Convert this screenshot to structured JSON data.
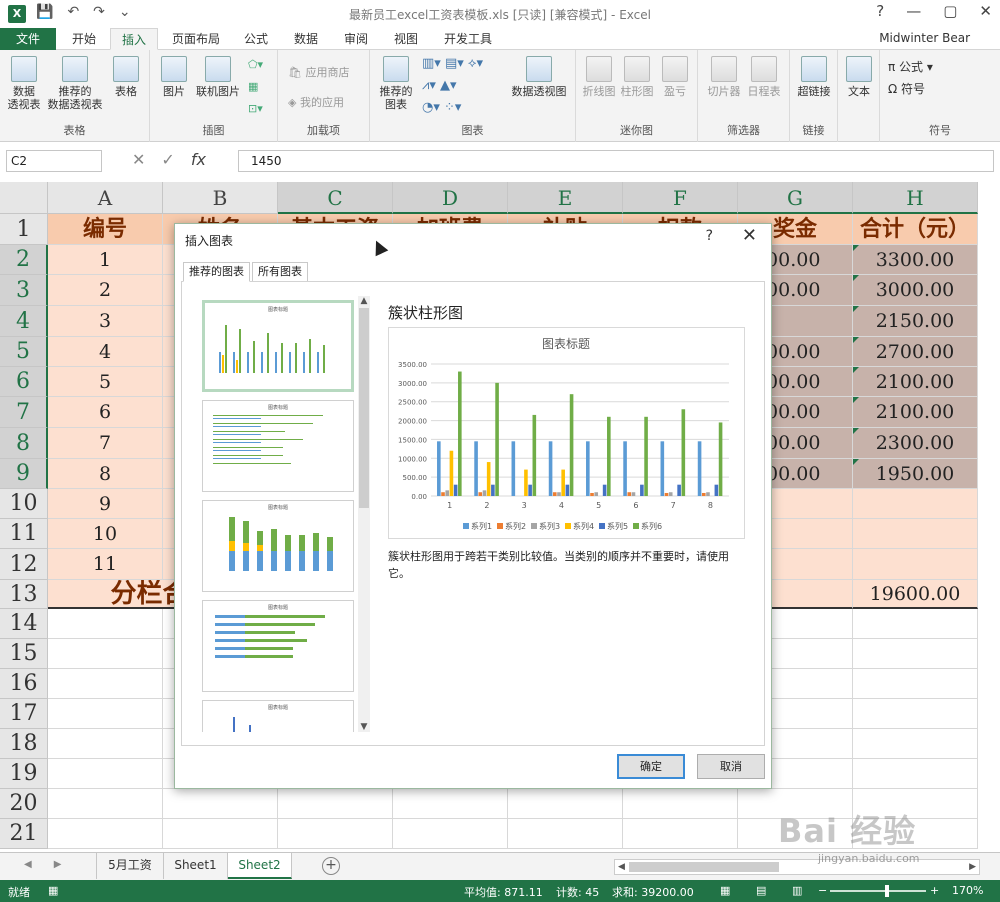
{
  "window": {
    "title": "最新员工excel工资表模板.xls [只读] [兼容模式] - Excel",
    "help": "?",
    "minimize": "—",
    "restore": "▢",
    "close": "✕"
  },
  "qat": {
    "save": "💾",
    "undo": "↶",
    "redo": "↷",
    "custom": "⌄"
  },
  "ribbon": {
    "file_tab": "文件",
    "tabs": [
      "开始",
      "插入",
      "页面布局",
      "公式",
      "数据",
      "审阅",
      "视图",
      "开发工具"
    ],
    "active_tab": "插入",
    "user": "Midwinter Bear",
    "groups": {
      "tables": {
        "label": "表格",
        "pivot": "数据\n透视表",
        "recommended_pivot": "推荐的\n数据透视表",
        "table": "表格"
      },
      "illustrations": {
        "label": "插图",
        "pictures": "图片",
        "online_pictures": "联机图片"
      },
      "addins": {
        "label": "加载项",
        "store": "应用商店",
        "my_apps": "我的应用"
      },
      "charts": {
        "label": "图表",
        "recommended": "推荐的\n图表",
        "pivot_chart": "数据透视图"
      },
      "sparklines": {
        "label": "迷你图",
        "line": "折线图",
        "column": "柱形图",
        "winloss": "盈亏"
      },
      "filters": {
        "label": "筛选器",
        "slicer": "切片器",
        "timeline": "日程表"
      },
      "links": {
        "label": "链接",
        "hyperlink": "超链接"
      },
      "text": {
        "label": "",
        "text": "文本"
      },
      "symbols": {
        "label": "符号",
        "equation": "公式",
        "symbol": "符号"
      }
    }
  },
  "formula_bar": {
    "name_box": "C2",
    "cancel": "✕",
    "enter": "✓",
    "fx": "fx",
    "formula": "1450"
  },
  "sheet": {
    "columns": [
      "A",
      "B",
      "C",
      "D",
      "E",
      "F",
      "G",
      "H"
    ],
    "rows": [
      "1",
      "2",
      "3",
      "4",
      "5",
      "6",
      "7",
      "8",
      "9",
      "10",
      "11",
      "12",
      "13",
      "14",
      "15",
      "16",
      "17",
      "18",
      "19",
      "20",
      "21"
    ],
    "header_row": {
      "A": "编号",
      "B": "姓名",
      "C": "基本工资",
      "D": "加班费",
      "E": "补贴",
      "F": "扣款",
      "G": "奖金",
      "H": "合计（元）"
    },
    "col_a": [
      "1",
      "2",
      "3",
      "4",
      "5",
      "6",
      "7",
      "8",
      "9",
      "10",
      "11"
    ],
    "col_g": [
      ".00.00",
      ".00.00",
      "",
      ".00.00",
      ".00.00",
      ".00.00",
      ".00.00",
      ".00.00"
    ],
    "col_h": [
      "3300.00",
      "3000.00",
      "2150.00",
      "2700.00",
      "2100.00",
      "2100.00",
      "2300.00",
      "1950.00"
    ],
    "total_label": "分栏合计",
    "total_value": "19600.00"
  },
  "dialog": {
    "title": "插入图表",
    "help": "?",
    "close": "✕",
    "tab_recommended": "推荐的图表",
    "tab_all": "所有图表",
    "chart_name": "簇状柱形图",
    "description": "簇状柱形图用于跨若干类别比较值。当类别的顺序并不重要时，请使用它。",
    "ok": "确定",
    "cancel": "取消",
    "thumb_title": "图表标题",
    "scroll_up": "▲",
    "scroll_down": "▼"
  },
  "chart_data": {
    "type": "bar",
    "title": "图表标题",
    "categories": [
      "1",
      "2",
      "3",
      "4",
      "5",
      "6",
      "7",
      "8"
    ],
    "ylim": [
      0,
      3500
    ],
    "yticks": [
      "0.00",
      "500.00",
      "1000.00",
      "1500.00",
      "2000.00",
      "2500.00",
      "3000.00",
      "3500.00"
    ],
    "series": [
      {
        "name": "系列1",
        "color": "#5b9bd5",
        "values": [
          1450,
          1450,
          1450,
          1450,
          1450,
          1450,
          1450,
          1450
        ]
      },
      {
        "name": "系列2",
        "color": "#ed7d31",
        "values": [
          100,
          100,
          0,
          100,
          80,
          100,
          80,
          80
        ]
      },
      {
        "name": "系列3",
        "color": "#a5a5a5",
        "values": [
          150,
          150,
          0,
          100,
          100,
          100,
          100,
          100
        ]
      },
      {
        "name": "系列4",
        "color": "#ffc000",
        "values": [
          1200,
          900,
          700,
          700,
          0,
          0,
          0,
          0
        ]
      },
      {
        "name": "系列5",
        "color": "#4472c4",
        "values": [
          300,
          300,
          300,
          300,
          300,
          300,
          300,
          300
        ]
      },
      {
        "name": "系列6",
        "color": "#70ad47",
        "values": [
          3300,
          3000,
          2150,
          2700,
          2100,
          2100,
          2300,
          1950
        ]
      }
    ],
    "legend": "bottom",
    "grid": true
  },
  "sheet_tabs": {
    "prev": "◀",
    "next": "▶",
    "tabs": [
      "5月工资",
      "Sheet1",
      "Sheet2"
    ],
    "active": "Sheet2",
    "add": "+"
  },
  "status": {
    "ready": "就绪",
    "average": "平均值: 871.11",
    "count": "计数: 45",
    "sum": "求和: 39200.00",
    "zoom": "170%",
    "zoom_minus": "−",
    "zoom_plus": "+"
  },
  "watermark": {
    "mark": "Bai 经验",
    "url": "jingyan.baidu.com"
  }
}
